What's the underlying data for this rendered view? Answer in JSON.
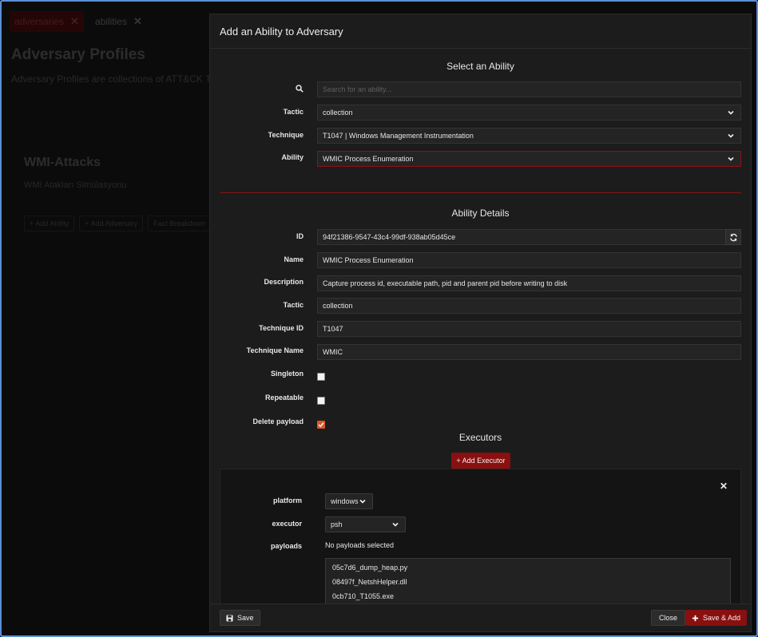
{
  "background": {
    "tabs": [
      {
        "label": "adversaries"
      },
      {
        "label": "abilities"
      }
    ],
    "title": "Adversary Profiles",
    "description": "Adversary Profiles are collections of ATT&CK TTPs",
    "card": {
      "title": "WMI-Attacks",
      "description": "WMI Atakları Simülasyonu",
      "actions": [
        "+ Add Ability",
        "+ Add Adversary",
        "Fact Breakdown"
      ]
    }
  },
  "modal": {
    "title": "Add an Ability to Adversary",
    "select_section": {
      "heading": "Select an Ability",
      "search_placeholder": "Search for an ability...",
      "tactic_label": "Tactic",
      "tactic_value": "collection",
      "technique_label": "Technique",
      "technique_value": "T1047 | Windows Management Instrumentation",
      "ability_label": "Ability",
      "ability_value": "WMIC Process Enumeration"
    },
    "details": {
      "heading": "Ability Details",
      "id_label": "ID",
      "id_value": "94f21386-9547-43c4-99df-938ab05d45ce",
      "name_label": "Name",
      "name_value": "WMIC Process Enumeration",
      "description_label": "Description",
      "description_value": "Capture process id, executable path, pid and parent pid before writing to disk",
      "tactic_label": "Tactic",
      "tactic_value": "collection",
      "technique_id_label": "Technique ID",
      "technique_id_value": "T1047",
      "technique_name_label": "Technique Name",
      "technique_name_value": "WMIC",
      "singleton_label": "Singleton",
      "repeatable_label": "Repeatable",
      "delete_payload_label": "Delete payload"
    },
    "executors": {
      "heading": "Executors",
      "add_button": "+ Add Executor",
      "platform_label": "platform",
      "platform_value": "windows",
      "executor_label": "executor",
      "executor_value": "psh",
      "payloads_label": "payloads",
      "payloads_status": "No payloads selected",
      "payload_options": [
        "05c7d6_dump_heap.py",
        "08497f_NetshHelper.dll",
        "0cb710_T1055.exe"
      ]
    },
    "footer": {
      "save": "Save",
      "close": "Close",
      "save_add": "Save & Add"
    }
  }
}
